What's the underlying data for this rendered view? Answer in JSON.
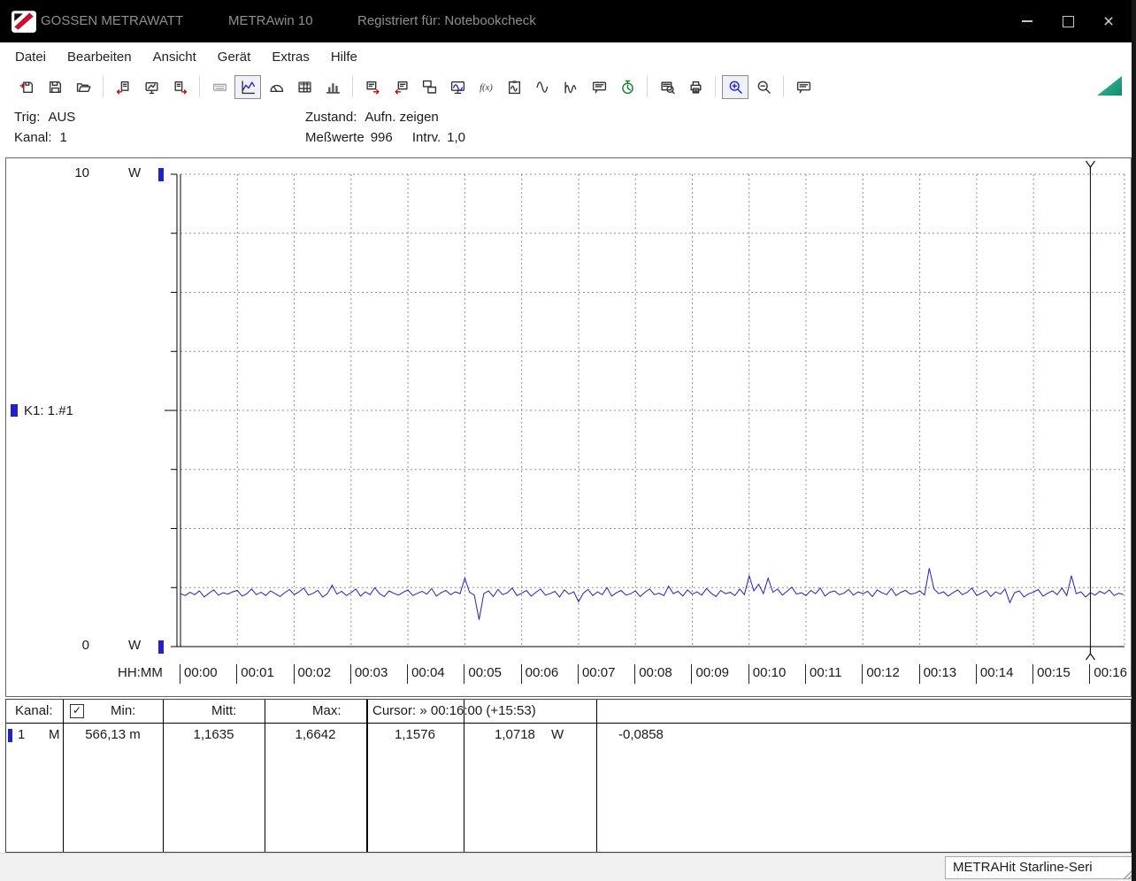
{
  "title_bar": {
    "brand": "GOSSEN METRAWATT",
    "app": "METRAwin 10",
    "registered": "Registriert für: Notebookcheck"
  },
  "menu": {
    "items": [
      {
        "id": "datei",
        "label": "Datei"
      },
      {
        "id": "bearbeiten",
        "label": "Bearbeiten"
      },
      {
        "id": "ansicht",
        "label": "Ansicht"
      },
      {
        "id": "geraet",
        "label": "Gerät"
      },
      {
        "id": "extras",
        "label": "Extras"
      },
      {
        "id": "hilfe",
        "label": "Hilfe"
      }
    ]
  },
  "toolbar": {
    "buttons": [
      {
        "name": "import-file",
        "icon": "disk-in"
      },
      {
        "name": "save-file",
        "icon": "disk"
      },
      {
        "name": "open-file",
        "icon": "folder"
      },
      {
        "sep": true
      },
      {
        "name": "read-from-device",
        "icon": "doc-in"
      },
      {
        "name": "device-online-display",
        "icon": "meter"
      },
      {
        "name": "send-to-device",
        "icon": "doc-out"
      },
      {
        "sep": true
      },
      {
        "name": "multimeter-view",
        "icon": "keyboard",
        "disabled": true
      },
      {
        "name": "chart-view",
        "icon": "linechart",
        "pressed": true
      },
      {
        "name": "analog-gauge-view",
        "icon": "gauge"
      },
      {
        "name": "table-view",
        "icon": "grid"
      },
      {
        "name": "bargraph-view",
        "icon": "bars"
      },
      {
        "sep": true
      },
      {
        "name": "export-window",
        "icon": "win-out"
      },
      {
        "name": "import-window",
        "icon": "win-in"
      },
      {
        "name": "arrange-windows",
        "icon": "win-tile"
      },
      {
        "name": "online-monitor",
        "icon": "monitor"
      },
      {
        "name": "formula-editor",
        "icon": "fx"
      },
      {
        "name": "screen-copy",
        "icon": "clip"
      },
      {
        "name": "signal-zoom",
        "icon": "wave"
      },
      {
        "name": "signal-overview",
        "icon": "wave2"
      },
      {
        "name": "notes",
        "icon": "note"
      },
      {
        "name": "record-timer",
        "icon": "timer"
      },
      {
        "sep": true
      },
      {
        "name": "print-preview",
        "icon": "preview"
      },
      {
        "name": "print",
        "icon": "print"
      },
      {
        "sep": true
      },
      {
        "name": "zoom-in-mode",
        "icon": "zoom",
        "pressed": true,
        "accent": true
      },
      {
        "name": "zoom-out",
        "icon": "zoom-out"
      },
      {
        "sep": true
      },
      {
        "name": "annotation",
        "icon": "note"
      }
    ]
  },
  "status_panel": {
    "trig_label": "Trig:",
    "trig_value": "AUS",
    "kanal_label": "Kanal:",
    "kanal_value": "1",
    "zustand_label": "Zustand:",
    "zustand_value": "Aufn. zeigen",
    "messwerte_label": "Meßwerte",
    "messwerte_value": "996",
    "intrv_label": "Intrv.",
    "intrv_value": "1,0"
  },
  "chart": {
    "y_max": "10",
    "y_min": "0",
    "y_unit": "W",
    "channel": "K1: 1.#1",
    "x_axis_label": "HH:MM",
    "x_ticks": [
      "00:00",
      "00:01",
      "00:02",
      "00:03",
      "00:04",
      "00:05",
      "00:06",
      "00:07",
      "00:08",
      "00:09",
      "00:10",
      "00:11",
      "00:12",
      "00:13",
      "00:14",
      "00:15",
      "00:16"
    ]
  },
  "chart_data": {
    "type": "line",
    "title": "",
    "xlabel": "HH:MM",
    "ylabel": "W",
    "ylim": [
      0,
      10
    ],
    "x_range_s": [
      0,
      996
    ],
    "grid": true,
    "cursor": {
      "time_s": 960,
      "time": "00:16:00",
      "elapsed": "+15:53"
    },
    "series": [
      {
        "name": "K1: 1.#1",
        "unit": "W",
        "color": "#2020cf",
        "interval_s": 5,
        "values": [
          1.12,
          1.08,
          1.15,
          1.1,
          1.18,
          1.05,
          1.13,
          1.2,
          1.09,
          1.14,
          1.11,
          1.16,
          1.19,
          1.07,
          1.12,
          1.22,
          1.1,
          1.15,
          1.08,
          1.18,
          1.12,
          1.06,
          1.14,
          1.21,
          1.1,
          1.16,
          1.24,
          1.09,
          1.13,
          1.19,
          1.05,
          1.12,
          1.3,
          1.11,
          1.17,
          1.08,
          1.14,
          1.22,
          1.07,
          1.16,
          1.1,
          1.25,
          1.12,
          1.06,
          1.18,
          1.13,
          1.09,
          1.15,
          1.2,
          1.08,
          1.13,
          1.17,
          1.11,
          1.23,
          1.07,
          1.14,
          1.19,
          1.1,
          1.16,
          1.12,
          1.45,
          1.15,
          1.09,
          0.57,
          1.12,
          1.18,
          1.06,
          1.21,
          1.1,
          1.14,
          1.24,
          1.08,
          1.13,
          1.19,
          1.07,
          1.15,
          1.22,
          1.09,
          1.12,
          1.17,
          1.05,
          1.2,
          1.11,
          1.16,
          0.95,
          1.13,
          1.21,
          1.08,
          1.16,
          1.1,
          1.25,
          1.07,
          1.14,
          1.19,
          1.09,
          1.12,
          1.18,
          1.06,
          1.15,
          1.22,
          1.1,
          1.13,
          1.08,
          1.28,
          1.12,
          1.17,
          1.07,
          1.2,
          1.11,
          1.16,
          1.09,
          1.23,
          1.13,
          1.06,
          1.19,
          1.12,
          1.15,
          1.08,
          1.22,
          1.1,
          1.5,
          1.18,
          1.32,
          1.12,
          1.45,
          1.15,
          1.22,
          1.09,
          1.17,
          1.26,
          1.11,
          1.14,
          1.08,
          1.19,
          1.12,
          1.24,
          1.07,
          1.15,
          1.18,
          1.1,
          1.13,
          1.21,
          1.09,
          1.16,
          1.12,
          1.17,
          1.06,
          1.2,
          1.14,
          1.1,
          1.23,
          1.08,
          1.15,
          1.19,
          1.11,
          1.13,
          1.18,
          1.09,
          1.66,
          1.22,
          1.12,
          1.16,
          1.07,
          1.14,
          1.2,
          1.1,
          1.15,
          1.24,
          1.08,
          1.13,
          1.19,
          1.06,
          1.16,
          1.11,
          1.22,
          0.93,
          1.14,
          1.18,
          1.05,
          1.12,
          1.15,
          1.21,
          1.07,
          1.13,
          1.18,
          1.1,
          1.24,
          1.08,
          1.5,
          1.12,
          1.16,
          1.05,
          1.14,
          1.09,
          1.17,
          1.12,
          1.2,
          1.08,
          1.13,
          1.1
        ]
      }
    ]
  },
  "stats_table": {
    "header": {
      "kanal": "Kanal:",
      "min": "Min:",
      "mitt": "Mitt:",
      "max": "Max:",
      "cursor": "Cursor: » 00:16:00 (+15:53)"
    },
    "row": {
      "channel": "1",
      "mode": "M",
      "min": "566,13 m",
      "mitt": "1,1635",
      "max": "1,6642",
      "cursor_value": "1,1576",
      "reference_value": "1,0718",
      "unit": "W",
      "delta": "-0,0858"
    }
  },
  "status_bar": {
    "device": "METRAHit Starline-Seri"
  }
}
